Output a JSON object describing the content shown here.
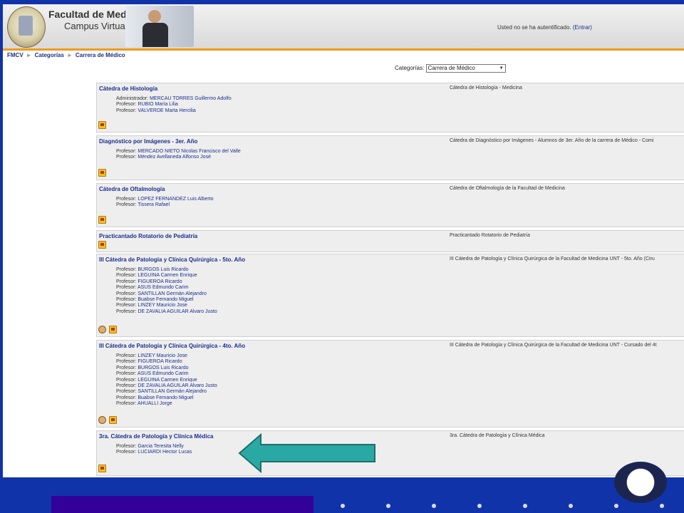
{
  "header": {
    "title": "Facultad de Medicina UNT",
    "subtitle": "Campus Virtual",
    "login_text": "Usted no se ha autentificado.",
    "login_link": "(Entrar)"
  },
  "breadcrumb": [
    "FMCV",
    "Categorías",
    "Carrera de Médico"
  ],
  "category_selector": {
    "label": "Categorías:",
    "selected": "Carrera de Médico"
  },
  "courses": [
    {
      "name": "Cátedra de Histología",
      "summary": "Cátedra de Histología - Medicina",
      "teachers": [
        {
          "role": "Administrador:",
          "name": "MERCAU TORRES Guillermo Adolfo"
        },
        {
          "role": "Profesor:",
          "name": "RUBIO María Lilia"
        },
        {
          "role": "Profesor:",
          "name": "VALVERDE Marta Hercilia"
        }
      ],
      "icons": [
        "key-icon"
      ]
    },
    {
      "name": "Diagnóstico por Imágenes - 3er. Año",
      "summary": "Cátedra de Diagnóstico por Imágenes - Alumnos de 3er. Año de la carrera de Médico - Comi",
      "teachers": [
        {
          "role": "Profesor:",
          "name": "MERCADO NIETO Nicolas Francisco del Valle"
        },
        {
          "role": "Profesor:",
          "name": "Méndez Avellaneda Alfonso José"
        }
      ],
      "icons": [
        "key-icon"
      ]
    },
    {
      "name": "Cátedra de Oftalmología",
      "summary": "Cátedra de Oftalmología de la Facultad de Medicina",
      "teachers": [
        {
          "role": "Profesor:",
          "name": "LOPEZ FERNANDEZ Luis Alberto"
        },
        {
          "role": "Profesor:",
          "name": "Tissera Rafael"
        }
      ],
      "icons": [
        "key-icon"
      ]
    },
    {
      "name": "Practicantado Rotatorio de Pediatría",
      "summary": "Practicantado Rotatorio de Pediatría",
      "teachers": [],
      "icons": [
        "key-icon"
      ]
    },
    {
      "name": "III Cátedra de Patología y Clínica Quirúrgica - 5to. Año",
      "summary": "III Cátedra de Patología y Clínica Quirúrgica de la Facultad de Medicina UNT - 5to. Año (Ciru",
      "teachers": [
        {
          "role": "Profesor:",
          "name": "BURGOS Luis Ricardo"
        },
        {
          "role": "Profesor:",
          "name": "LEGUINA Carmen Enrique"
        },
        {
          "role": "Profesor:",
          "name": "FIGUEROA Ricardo"
        },
        {
          "role": "Profesor:",
          "name": "ASUS Edmundo Carim"
        },
        {
          "role": "Profesor:",
          "name": "SANTILLAN Germán Alejandro"
        },
        {
          "role": "Profesor:",
          "name": "Buabse Fernando Miguel"
        },
        {
          "role": "Profesor:",
          "name": "LINZEY Mauricio Jose"
        },
        {
          "role": "Profesor:",
          "name": "DE ZAVALIA AGUILAR Alvaro Justo"
        }
      ],
      "icons": [
        "guest-icon",
        "key-icon"
      ]
    },
    {
      "name": "III Cátedra de Patología y Clínica Quirúrgica - 4to. Año",
      "summary": "III Cátedra de Patología y Clínica Quirúrgica de la Facultad de Medicina UNT - Cursado del 4t",
      "teachers": [
        {
          "role": "Profesor:",
          "name": "LINZEY Mauricio Jose"
        },
        {
          "role": "Profesor:",
          "name": "FIGUEROA Ricardo"
        },
        {
          "role": "Profesor:",
          "name": "BURGOS Luis Ricardo"
        },
        {
          "role": "Profesor:",
          "name": "ASUS Edmundo Carim"
        },
        {
          "role": "Profesor:",
          "name": "LEGUINA Carmen Enrique"
        },
        {
          "role": "Profesor:",
          "name": "DE ZAVALIA AGUILAR Alvaro Justo"
        },
        {
          "role": "Profesor:",
          "name": "SANTILLAN Germán Alejandro"
        },
        {
          "role": "Profesor:",
          "name": "Buabse Fernando Miguel"
        },
        {
          "role": "Profesor:",
          "name": "AHUALLI Jorge"
        }
      ],
      "icons": [
        "guest-icon",
        "key-icon"
      ]
    },
    {
      "name": "3ra. Cátedra de Patología y Clínica Médica",
      "summary": "3ra. Cátedra de Patología y Clínica Médica",
      "teachers": [
        {
          "role": "Profesor:",
          "name": "Garcia Teresita Nelly"
        },
        {
          "role": "Profesor:",
          "name": "LUCIARDI Hector Lucas"
        }
      ],
      "icons": [
        "key-icon"
      ]
    }
  ],
  "colors": {
    "link": "#1a2f8c",
    "accent_orange": "#f29a1a",
    "slide_background": "#1133aa",
    "arrow_fill": "#2aa8a4"
  }
}
